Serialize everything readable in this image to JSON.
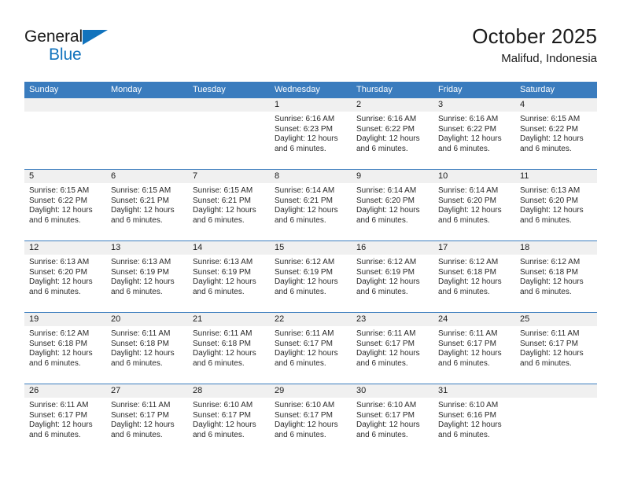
{
  "brand": {
    "name_part1": "General",
    "name_part2": "Blue",
    "triangle_color": "#1173bd",
    "text_color": "#1b1b1b"
  },
  "header": {
    "title": "October 2025",
    "subtitle": "Malifud, Indonesia"
  },
  "colors": {
    "header_bar": "#3a7cbe",
    "date_band": "#f0f0f0",
    "row_divider": "#3a7cbe",
    "body_text": "#2a2a2a"
  },
  "weekday_headers": [
    "Sunday",
    "Monday",
    "Tuesday",
    "Wednesday",
    "Thursday",
    "Friday",
    "Saturday"
  ],
  "labels": {
    "sunrise_prefix": "Sunrise:",
    "sunset_prefix": "Sunset:",
    "daylight_prefix": "Daylight:"
  },
  "weeks": [
    [
      {
        "empty": true
      },
      {
        "empty": true
      },
      {
        "empty": true
      },
      {
        "day": "1",
        "sunrise": "Sunrise: 6:16 AM",
        "sunset": "Sunset: 6:23 PM",
        "daylight1": "Daylight: 12 hours",
        "daylight2": "and 6 minutes."
      },
      {
        "day": "2",
        "sunrise": "Sunrise: 6:16 AM",
        "sunset": "Sunset: 6:22 PM",
        "daylight1": "Daylight: 12 hours",
        "daylight2": "and 6 minutes."
      },
      {
        "day": "3",
        "sunrise": "Sunrise: 6:16 AM",
        "sunset": "Sunset: 6:22 PM",
        "daylight1": "Daylight: 12 hours",
        "daylight2": "and 6 minutes."
      },
      {
        "day": "4",
        "sunrise": "Sunrise: 6:15 AM",
        "sunset": "Sunset: 6:22 PM",
        "daylight1": "Daylight: 12 hours",
        "daylight2": "and 6 minutes."
      }
    ],
    [
      {
        "day": "5",
        "sunrise": "Sunrise: 6:15 AM",
        "sunset": "Sunset: 6:22 PM",
        "daylight1": "Daylight: 12 hours",
        "daylight2": "and 6 minutes."
      },
      {
        "day": "6",
        "sunrise": "Sunrise: 6:15 AM",
        "sunset": "Sunset: 6:21 PM",
        "daylight1": "Daylight: 12 hours",
        "daylight2": "and 6 minutes."
      },
      {
        "day": "7",
        "sunrise": "Sunrise: 6:15 AM",
        "sunset": "Sunset: 6:21 PM",
        "daylight1": "Daylight: 12 hours",
        "daylight2": "and 6 minutes."
      },
      {
        "day": "8",
        "sunrise": "Sunrise: 6:14 AM",
        "sunset": "Sunset: 6:21 PM",
        "daylight1": "Daylight: 12 hours",
        "daylight2": "and 6 minutes."
      },
      {
        "day": "9",
        "sunrise": "Sunrise: 6:14 AM",
        "sunset": "Sunset: 6:20 PM",
        "daylight1": "Daylight: 12 hours",
        "daylight2": "and 6 minutes."
      },
      {
        "day": "10",
        "sunrise": "Sunrise: 6:14 AM",
        "sunset": "Sunset: 6:20 PM",
        "daylight1": "Daylight: 12 hours",
        "daylight2": "and 6 minutes."
      },
      {
        "day": "11",
        "sunrise": "Sunrise: 6:13 AM",
        "sunset": "Sunset: 6:20 PM",
        "daylight1": "Daylight: 12 hours",
        "daylight2": "and 6 minutes."
      }
    ],
    [
      {
        "day": "12",
        "sunrise": "Sunrise: 6:13 AM",
        "sunset": "Sunset: 6:20 PM",
        "daylight1": "Daylight: 12 hours",
        "daylight2": "and 6 minutes."
      },
      {
        "day": "13",
        "sunrise": "Sunrise: 6:13 AM",
        "sunset": "Sunset: 6:19 PM",
        "daylight1": "Daylight: 12 hours",
        "daylight2": "and 6 minutes."
      },
      {
        "day": "14",
        "sunrise": "Sunrise: 6:13 AM",
        "sunset": "Sunset: 6:19 PM",
        "daylight1": "Daylight: 12 hours",
        "daylight2": "and 6 minutes."
      },
      {
        "day": "15",
        "sunrise": "Sunrise: 6:12 AM",
        "sunset": "Sunset: 6:19 PM",
        "daylight1": "Daylight: 12 hours",
        "daylight2": "and 6 minutes."
      },
      {
        "day": "16",
        "sunrise": "Sunrise: 6:12 AM",
        "sunset": "Sunset: 6:19 PM",
        "daylight1": "Daylight: 12 hours",
        "daylight2": "and 6 minutes."
      },
      {
        "day": "17",
        "sunrise": "Sunrise: 6:12 AM",
        "sunset": "Sunset: 6:18 PM",
        "daylight1": "Daylight: 12 hours",
        "daylight2": "and 6 minutes."
      },
      {
        "day": "18",
        "sunrise": "Sunrise: 6:12 AM",
        "sunset": "Sunset: 6:18 PM",
        "daylight1": "Daylight: 12 hours",
        "daylight2": "and 6 minutes."
      }
    ],
    [
      {
        "day": "19",
        "sunrise": "Sunrise: 6:12 AM",
        "sunset": "Sunset: 6:18 PM",
        "daylight1": "Daylight: 12 hours",
        "daylight2": "and 6 minutes."
      },
      {
        "day": "20",
        "sunrise": "Sunrise: 6:11 AM",
        "sunset": "Sunset: 6:18 PM",
        "daylight1": "Daylight: 12 hours",
        "daylight2": "and 6 minutes."
      },
      {
        "day": "21",
        "sunrise": "Sunrise: 6:11 AM",
        "sunset": "Sunset: 6:18 PM",
        "daylight1": "Daylight: 12 hours",
        "daylight2": "and 6 minutes."
      },
      {
        "day": "22",
        "sunrise": "Sunrise: 6:11 AM",
        "sunset": "Sunset: 6:17 PM",
        "daylight1": "Daylight: 12 hours",
        "daylight2": "and 6 minutes."
      },
      {
        "day": "23",
        "sunrise": "Sunrise: 6:11 AM",
        "sunset": "Sunset: 6:17 PM",
        "daylight1": "Daylight: 12 hours",
        "daylight2": "and 6 minutes."
      },
      {
        "day": "24",
        "sunrise": "Sunrise: 6:11 AM",
        "sunset": "Sunset: 6:17 PM",
        "daylight1": "Daylight: 12 hours",
        "daylight2": "and 6 minutes."
      },
      {
        "day": "25",
        "sunrise": "Sunrise: 6:11 AM",
        "sunset": "Sunset: 6:17 PM",
        "daylight1": "Daylight: 12 hours",
        "daylight2": "and 6 minutes."
      }
    ],
    [
      {
        "day": "26",
        "sunrise": "Sunrise: 6:11 AM",
        "sunset": "Sunset: 6:17 PM",
        "daylight1": "Daylight: 12 hours",
        "daylight2": "and 6 minutes."
      },
      {
        "day": "27",
        "sunrise": "Sunrise: 6:11 AM",
        "sunset": "Sunset: 6:17 PM",
        "daylight1": "Daylight: 12 hours",
        "daylight2": "and 6 minutes."
      },
      {
        "day": "28",
        "sunrise": "Sunrise: 6:10 AM",
        "sunset": "Sunset: 6:17 PM",
        "daylight1": "Daylight: 12 hours",
        "daylight2": "and 6 minutes."
      },
      {
        "day": "29",
        "sunrise": "Sunrise: 6:10 AM",
        "sunset": "Sunset: 6:17 PM",
        "daylight1": "Daylight: 12 hours",
        "daylight2": "and 6 minutes."
      },
      {
        "day": "30",
        "sunrise": "Sunrise: 6:10 AM",
        "sunset": "Sunset: 6:17 PM",
        "daylight1": "Daylight: 12 hours",
        "daylight2": "and 6 minutes."
      },
      {
        "day": "31",
        "sunrise": "Sunrise: 6:10 AM",
        "sunset": "Sunset: 6:16 PM",
        "daylight1": "Daylight: 12 hours",
        "daylight2": "and 6 minutes."
      },
      {
        "empty": true
      }
    ]
  ]
}
